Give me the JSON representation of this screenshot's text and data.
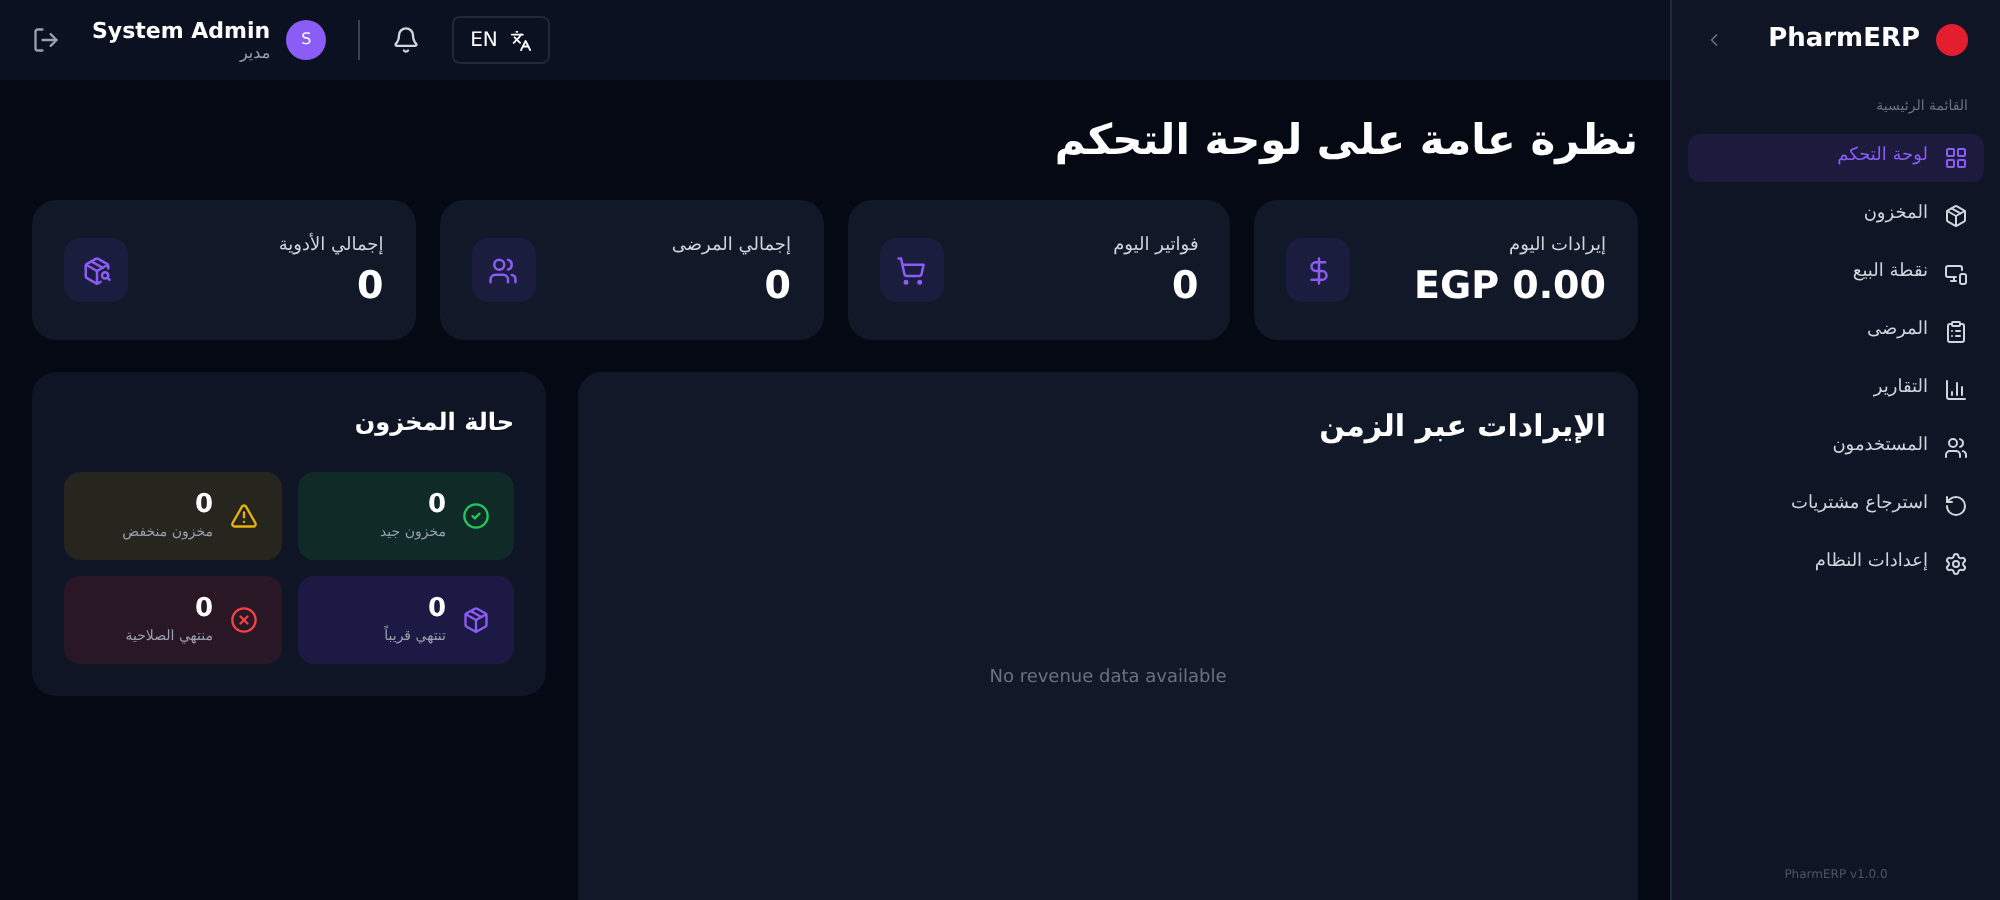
{
  "header": {
    "user_name": "System Admin",
    "user_role": "مدير",
    "avatar": "S",
    "language": "EN"
  },
  "page_title": "نظرة عامة على لوحة التحكم",
  "stats": [
    {
      "label": "إيرادات اليوم",
      "value": "EGP 0.00"
    },
    {
      "label": "فواتير اليوم",
      "value": "0"
    },
    {
      "label": "إجمالي المرضى",
      "value": "0"
    },
    {
      "label": "إجمالي الأدوية",
      "value": "0"
    }
  ],
  "revenue_panel": {
    "title": "الإيرادات عبر الزمن",
    "empty_message": "No revenue data available"
  },
  "stock_panel": {
    "title": "حالة المخزون",
    "tiles": [
      {
        "kind": "good",
        "value": "0",
        "label": "مخزون جيد"
      },
      {
        "kind": "low",
        "value": "0",
        "label": "مخزون منخفض"
      },
      {
        "kind": "expiring",
        "value": "0",
        "label": "تنتهي قريباً"
      },
      {
        "kind": "expired",
        "value": "0",
        "label": "منتهي الصلاحية"
      }
    ]
  },
  "sidebar": {
    "brand": "PharmERP",
    "section": "القائمة الرئيسية",
    "items": [
      {
        "label": "لوحة التحكم",
        "selected": true
      },
      {
        "label": "المخزون",
        "selected": false
      },
      {
        "label": "نقطة البيع",
        "selected": false
      },
      {
        "label": "المرضى",
        "selected": false
      },
      {
        "label": "التقارير",
        "selected": false
      },
      {
        "label": "المستخدمون",
        "selected": false
      },
      {
        "label": "استرجاع مشتريات",
        "selected": false
      },
      {
        "label": "إعدادات النظام",
        "selected": false
      }
    ],
    "version": "PharmERP v1.0.0"
  }
}
